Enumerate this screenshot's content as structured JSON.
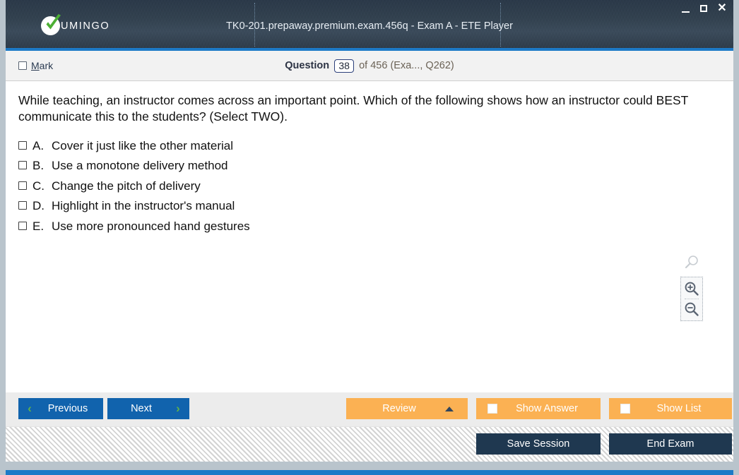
{
  "window": {
    "title": "TK0-201.prepaway.premium.exam.456q - Exam A - ETE Player",
    "brand": "UMINGO",
    "controls": {
      "minimize": "_",
      "maximize": "",
      "close": "✕"
    }
  },
  "header": {
    "mark_label_accel": "M",
    "mark_label_rest": "ark",
    "question_word": "Question",
    "question_number": "38",
    "question_rest": "of 456 (Exa..., Q262)"
  },
  "question": {
    "text": "While teaching, an instructor comes across an important point. Which of the following shows how an instructor could BEST communicate this to the students? (Select TWO).",
    "options": [
      {
        "letter": "A.",
        "text": "Cover it just like the other material",
        "checked": false
      },
      {
        "letter": "B.",
        "text": "Use a monotone delivery method",
        "checked": false
      },
      {
        "letter": "C.",
        "text": "Change the pitch of delivery",
        "checked": false
      },
      {
        "letter": "D.",
        "text": "Highlight in the instructor's manual",
        "checked": false
      },
      {
        "letter": "E.",
        "text": "Use more pronounced hand gestures",
        "checked": false
      }
    ]
  },
  "zoom_tools": {
    "handle_icon": "magnifier-icon",
    "zoom_in_icon": "magnifier-plus-icon",
    "zoom_out_icon": "magnifier-minus-icon"
  },
  "navbar": {
    "previous": "Previous",
    "next": "Next",
    "review": "Review",
    "show_answer": "Show Answer",
    "show_list": "Show List",
    "prev_chevron": "‹",
    "next_chevron": "›"
  },
  "footer": {
    "save_session": "Save Session",
    "end_exam": "End Exam"
  },
  "colors": {
    "titlebar": "#32414f",
    "accent_blue": "#1d7ac7",
    "button_blue": "#1163ad",
    "button_orange": "#fbb153",
    "button_dark": "#1f3850",
    "check_green": "#4caf34",
    "chevron_green": "#5fb14b"
  }
}
